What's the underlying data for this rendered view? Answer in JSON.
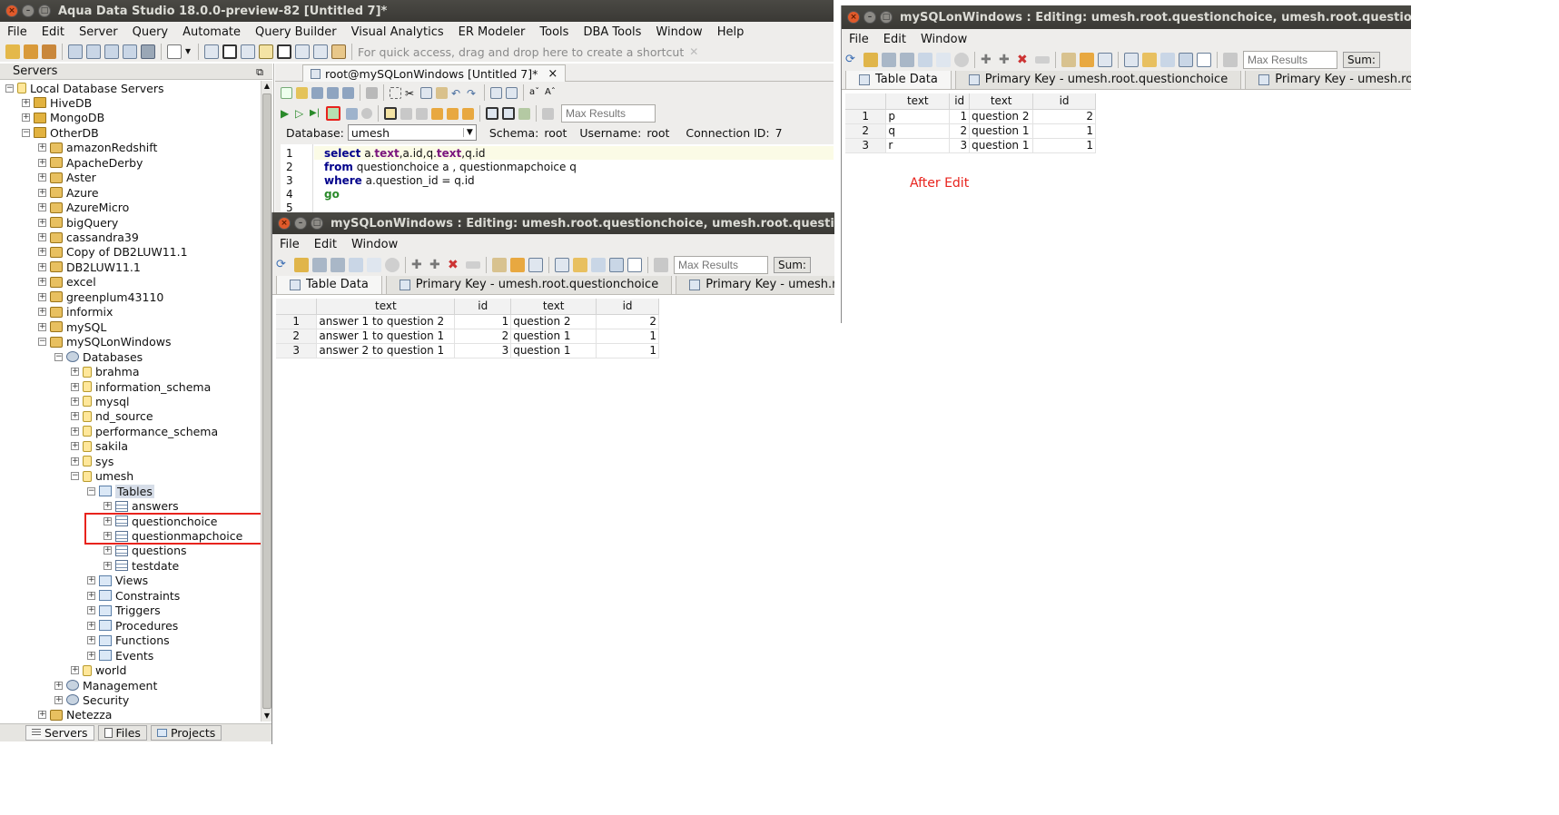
{
  "main": {
    "title": "Aqua Data Studio 18.0.0-preview-82 [Untitled 7]*",
    "menu": [
      "File",
      "Edit",
      "Server",
      "Query",
      "Automate",
      "Query Builder",
      "Visual Analytics",
      "ER Modeler",
      "Tools",
      "DBA Tools",
      "Window",
      "Help"
    ],
    "quick_access": "For quick access, drag and drop here to create a shortcut",
    "servers_panel_title": "Servers",
    "bottom_tabs": [
      "Servers",
      "Files",
      "Projects"
    ]
  },
  "tree": [
    {
      "label": "Local Database Servers",
      "level": 0,
      "icon": "cyl",
      "exp": "−"
    },
    {
      "label": "HiveDB",
      "level": 1,
      "icon": "folder",
      "exp": "+"
    },
    {
      "label": "MongoDB",
      "level": 1,
      "icon": "folder",
      "exp": "+"
    },
    {
      "label": "OtherDB",
      "level": 1,
      "icon": "folder",
      "exp": "−"
    },
    {
      "label": "amazonRedshift",
      "level": 2,
      "icon": "db",
      "exp": "+"
    },
    {
      "label": "ApacheDerby",
      "level": 2,
      "icon": "db",
      "exp": "+"
    },
    {
      "label": "Aster",
      "level": 2,
      "icon": "db",
      "exp": "+"
    },
    {
      "label": "Azure",
      "level": 2,
      "icon": "db",
      "exp": "+"
    },
    {
      "label": "AzureMicro",
      "level": 2,
      "icon": "db",
      "exp": "+"
    },
    {
      "label": "bigQuery",
      "level": 2,
      "icon": "db",
      "exp": "+"
    },
    {
      "label": "cassandra39",
      "level": 2,
      "icon": "db",
      "exp": "+"
    },
    {
      "label": "Copy of DB2LUW11.1",
      "level": 2,
      "icon": "db",
      "exp": "+"
    },
    {
      "label": "DB2LUW11.1",
      "level": 2,
      "icon": "db",
      "exp": "+"
    },
    {
      "label": "excel",
      "level": 2,
      "icon": "db",
      "exp": "+"
    },
    {
      "label": "greenplum43110",
      "level": 2,
      "icon": "db",
      "exp": "+"
    },
    {
      "label": "informix",
      "level": 2,
      "icon": "db",
      "exp": "+"
    },
    {
      "label": "mySQL",
      "level": 2,
      "icon": "db",
      "exp": "+"
    },
    {
      "label": "mySQLonWindows",
      "level": 2,
      "icon": "db",
      "exp": "−"
    },
    {
      "label": "Databases",
      "level": 3,
      "icon": "gear",
      "exp": "−"
    },
    {
      "label": "brahma",
      "level": 4,
      "icon": "cyl",
      "exp": "+"
    },
    {
      "label": "information_schema",
      "level": 4,
      "icon": "cyl",
      "exp": "+"
    },
    {
      "label": "mysql",
      "level": 4,
      "icon": "cyl",
      "exp": "+"
    },
    {
      "label": "nd_source",
      "level": 4,
      "icon": "cyl",
      "exp": "+"
    },
    {
      "label": "performance_schema",
      "level": 4,
      "icon": "cyl",
      "exp": "+"
    },
    {
      "label": "sakila",
      "level": 4,
      "icon": "cyl",
      "exp": "+"
    },
    {
      "label": "sys",
      "level": 4,
      "icon": "cyl",
      "exp": "+"
    },
    {
      "label": "umesh",
      "level": 4,
      "icon": "cyl",
      "exp": "−"
    },
    {
      "label": "Tables",
      "level": 5,
      "icon": "fold2",
      "exp": "−",
      "selected": true
    },
    {
      "label": "answers",
      "level": 6,
      "icon": "tbl",
      "exp": "+"
    },
    {
      "label": "questionchoice",
      "level": 6,
      "icon": "tbl",
      "exp": "+"
    },
    {
      "label": "questionmapchoice",
      "level": 6,
      "icon": "tbl",
      "exp": "+"
    },
    {
      "label": "questions",
      "level": 6,
      "icon": "tbl",
      "exp": "+"
    },
    {
      "label": "testdate",
      "level": 6,
      "icon": "tbl",
      "exp": "+"
    },
    {
      "label": "Views",
      "level": 5,
      "icon": "fold2",
      "exp": "+"
    },
    {
      "label": "Constraints",
      "level": 5,
      "icon": "fold2",
      "exp": "+"
    },
    {
      "label": "Triggers",
      "level": 5,
      "icon": "fold2",
      "exp": "+"
    },
    {
      "label": "Procedures",
      "level": 5,
      "icon": "fold2",
      "exp": "+"
    },
    {
      "label": "Functions",
      "level": 5,
      "icon": "fold2",
      "exp": "+"
    },
    {
      "label": "Events",
      "level": 5,
      "icon": "fold2",
      "exp": "+"
    },
    {
      "label": "world",
      "level": 4,
      "icon": "cyl",
      "exp": "+"
    },
    {
      "label": "Management",
      "level": 3,
      "icon": "gear",
      "exp": "+"
    },
    {
      "label": "Security",
      "level": 3,
      "icon": "gear",
      "exp": "+"
    },
    {
      "label": "Netezza",
      "level": 2,
      "icon": "db",
      "exp": "+"
    }
  ],
  "editor": {
    "tab_label": "root@mySQLonWindows [Untitled 7]*",
    "tab_close": "×",
    "max_results_placeholder": "Max Results",
    "database_label": "Database:",
    "database_value": "umesh",
    "schema_label": "Schema:",
    "schema_value": "root",
    "username_label": "Username:",
    "username_value": "root",
    "connection_label": "Connection ID:",
    "connection_value": "7",
    "line_numbers": [
      "1",
      "2",
      "3",
      "4",
      "5"
    ]
  },
  "edit_window_mid": {
    "title": "mySQLonWindows : Editing: umesh.root.questionchoice, umesh.root.questionmapchoice",
    "menu": [
      "File",
      "Edit",
      "Window"
    ],
    "max_results_placeholder": "Max Results",
    "sum_label": "Sum:",
    "tabs": [
      "Table Data",
      "Primary Key - umesh.root.questionchoice",
      "Primary Key - umesh.root.questionmapchoice"
    ],
    "columns": [
      "text",
      "id",
      "text",
      "id"
    ],
    "rows": [
      {
        "n": "1",
        "c1": "answer 1 to question 2",
        "c2": "1",
        "c3": "question 2",
        "c4": "2"
      },
      {
        "n": "2",
        "c1": "answer 1 to question 1",
        "c2": "2",
        "c3": "question 1",
        "c4": "1"
      },
      {
        "n": "3",
        "c1": "answer 2 to question 1",
        "c2": "3",
        "c3": "question 1",
        "c4": "1"
      }
    ]
  },
  "edit_window_right": {
    "title": "mySQLonWindows : Editing: umesh.root.questionchoice, umesh.root.questionmapchoice",
    "menu": [
      "File",
      "Edit",
      "Window"
    ],
    "max_results_placeholder": "Max Results",
    "sum_label": "Sum:",
    "tabs": [
      "Table Data",
      "Primary Key - umesh.root.questionchoice",
      "Primary Key - umesh.root.questionmapchoice"
    ],
    "columns": [
      "text",
      "id",
      "text",
      "id"
    ],
    "rows": [
      {
        "n": "1",
        "c1": "p",
        "c2": "1",
        "c3": "question 2",
        "c4": "2"
      },
      {
        "n": "2",
        "c1": "q",
        "c2": "2",
        "c3": "question 1",
        "c4": "1"
      },
      {
        "n": "3",
        "c1": "r",
        "c2": "3",
        "c3": "question 1",
        "c4": "1"
      }
    ],
    "annotation": "After Edit",
    "annotation_color": "#e8231d"
  },
  "colors": {
    "highlight_box": "#e8231d",
    "selection_bg": "#d6dde8"
  }
}
